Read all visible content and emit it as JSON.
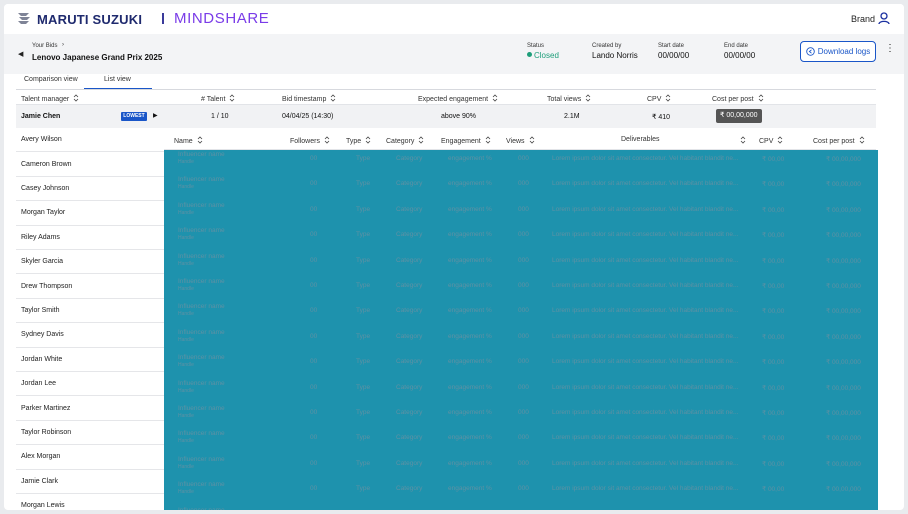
{
  "header": {
    "brand": "MARUTI SUZUKI",
    "partner": "MINDSHARE",
    "brand_link": "Brand",
    "logo_icon": "suzuki-logo-icon",
    "user_icon": "user-icon",
    "colors": {
      "brand": "#1f2a6e",
      "partner": "#7a3ce8",
      "accent": "#1a56c8"
    }
  },
  "bid": {
    "breadcrumb": "Your Bids",
    "title": "Lenovo Japanese Grand Prix 2025",
    "status_label": "Status",
    "status_value": "Closed",
    "created_label": "Created by",
    "created_value": "Lando Norris",
    "start_label": "Start date",
    "start_value": "00/00/00",
    "end_label": "End date",
    "end_value": "00/00/00",
    "download_label": "Download logs",
    "status_color": "#1e9e7a"
  },
  "tabs": {
    "comparison": "Comparison view",
    "list": "List view",
    "active": "List view"
  },
  "columns": {
    "talent_manager": "Talent manager",
    "talent": "# Talent",
    "bid_timestamp": "Bid timestamp",
    "expected_engagement": "Expected engagement",
    "total_views": "Total views",
    "cpv": "CPV",
    "cost_per_post": "Cost per post"
  },
  "selected_row": {
    "name": "Jamie Chen",
    "badge": "LOWEST",
    "talent": "1 / 10",
    "bid_timestamp": "04/04/25 (14:30)",
    "expected_engagement": "above 90%",
    "total_views": "2.1M",
    "cpv": "₹ 410",
    "cost_per_post": "₹ 00,00,000"
  },
  "talent_managers": [
    "Avery Wilson",
    "Cameron Brown",
    "Casey Johnson",
    "Morgan Taylor",
    "Riley Adams",
    "Skyler Garcia",
    "Drew Thompson",
    "Taylor Smith",
    "Sydney Davis",
    "Jordan White",
    "Jordan Lee",
    "Parker Martinez",
    "Taylor Robinson",
    "Alex Morgan",
    "Jamie Clark",
    "Morgan Lewis"
  ],
  "detail_columns": {
    "name": "Name",
    "followers": "Followers",
    "type": "Type",
    "category": "Category",
    "engagement": "Engagement",
    "views": "Views",
    "deliverables": "Deliverables",
    "cpv": "CPV",
    "cost_per_post": "Cost per post"
  },
  "influencer_placeholder": {
    "name": "Influencer name",
    "handle": "Handle",
    "followers": "00",
    "type": "Type",
    "category": "Category",
    "engagement": "engagement %",
    "views": "000",
    "deliverables": "Lorem ipsum dolor sit amet consectetur. Vel habitant blandit ne...",
    "cpv": "₹ 00,00",
    "cost_per_post": "₹ 00,00,000"
  },
  "overlay_color": "#1e92ad"
}
